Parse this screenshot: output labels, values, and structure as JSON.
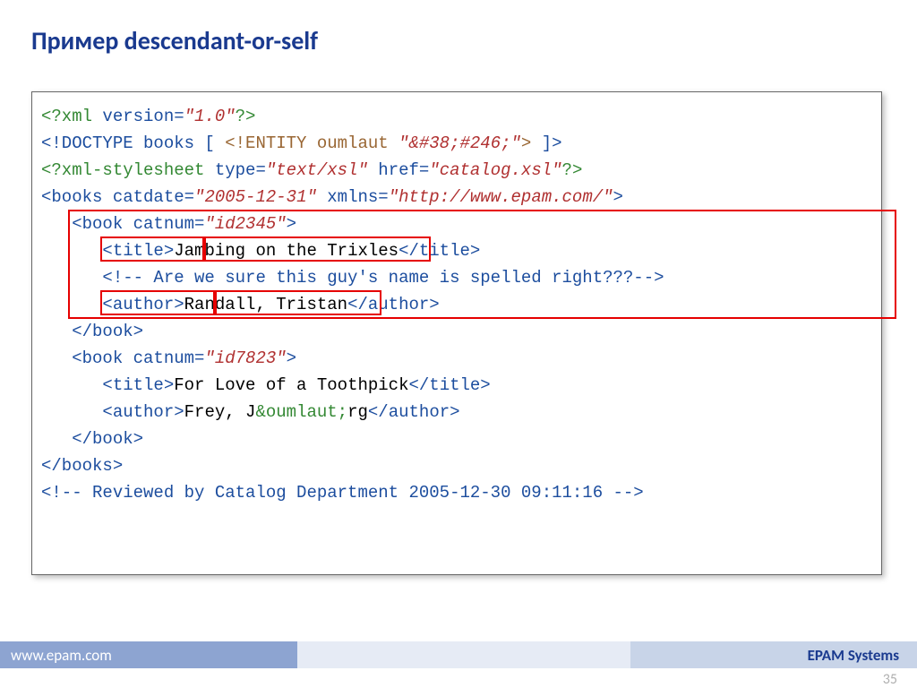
{
  "title": "Пример descendant-or-self",
  "code": {
    "l1_open": "<?xml",
    "l1_ver": " version=",
    "l1_val": "\"1.0\"",
    "l1_close": "?>",
    "l2_a": "<!DOCTYPE books [ ",
    "l2_b": "<!ENTITY oumlaut ",
    "l2_c": "\"&#38;#246;\"",
    "l2_d": ">",
    "l2_e": " ]>",
    "l3_a": "<?xml-stylesheet",
    "l3_b": " type=",
    "l3_c": "\"text/xsl\"",
    "l3_d": " href=",
    "l3_e": "\"catalog.xsl\"",
    "l3_f": "?>",
    "l4_a": "<books",
    "l4_b": " catdate=",
    "l4_c": "\"2005-12-31\"",
    "l4_d": " xmlns=",
    "l4_e": "\"http://www.epam.com/\"",
    "l4_f": ">",
    "l5_a": "   <book",
    "l5_b": " catnum=",
    "l5_c": "\"id2345\"",
    "l5_d": ">",
    "l6_a": "      <title>",
    "l6_b": "Jambing on the Trixles",
    "l6_c": "</title>",
    "l7": "      <!-- Are we sure this guy's name is spelled right???-->",
    "l8_a": "      <author>",
    "l8_b": "Randall, Tristan",
    "l8_c": "</author>",
    "l9": "   </book>",
    "l10_a": "   <book",
    "l10_b": " catnum=",
    "l10_c": "\"id7823\"",
    "l10_d": ">",
    "l11_a": "      <title>",
    "l11_b": "For Love of a Toothpick",
    "l11_c": "</title>",
    "l12_a": "      <author>",
    "l12_b": "Frey, J",
    "l12_c": "&oumlaut;",
    "l12_d": "rg",
    "l12_e": "</author>",
    "l13": "   </book>",
    "l14": "</books>",
    "l15": "<!-- Reviewed by Catalog Department 2005-12-30 09:11:16 -->"
  },
  "footer_left": "www.epam.com",
  "footer_right": "EPAM Systems",
  "page": "35"
}
